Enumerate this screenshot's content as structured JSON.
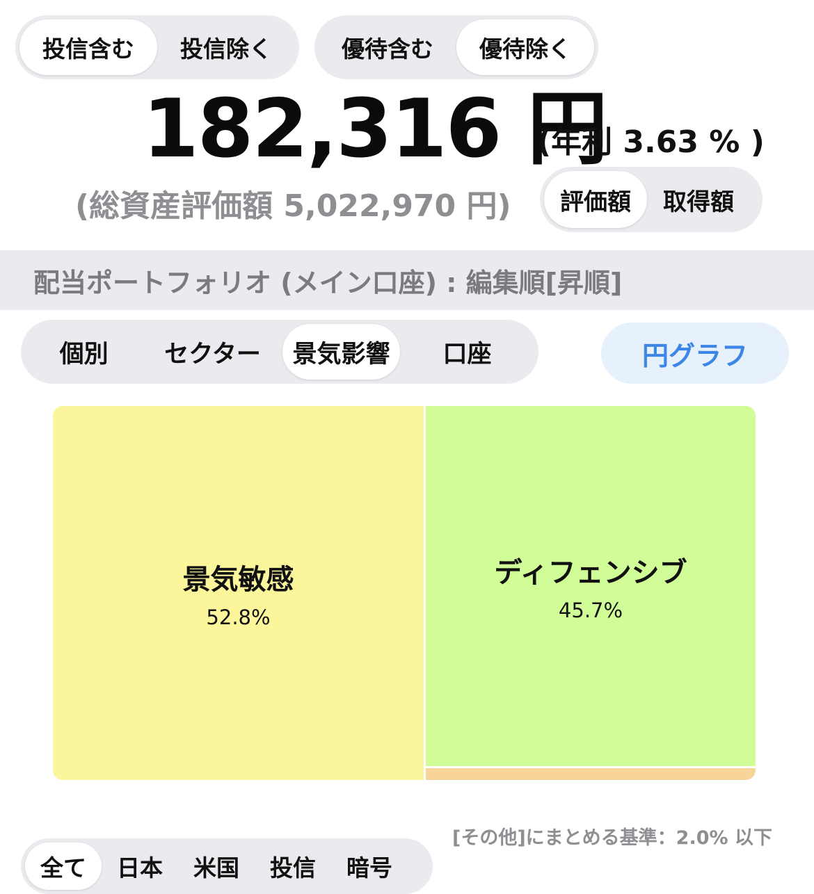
{
  "fund_toggle": {
    "options": [
      "投信含む",
      "投信除く"
    ],
    "selected": "投信含む"
  },
  "yutai_toggle": {
    "options": [
      "優待含む",
      "優待除く"
    ],
    "selected": "優待除く"
  },
  "annual_dividend": {
    "amount": "182,316 円",
    "yield_text": "(年利 3.63 % )"
  },
  "total_assets_text": "(総資産評価額 5,022,970 円)",
  "value_toggle": {
    "options": [
      "評価額",
      "取得額"
    ],
    "selected": "評価額"
  },
  "portfolio_title": "配当ポートフォリオ (メイン口座) : 編集順[昇順]",
  "category_tabs": {
    "options": [
      "個別",
      "セクター",
      "景気影響",
      "口座"
    ],
    "selected": "景気影響"
  },
  "chart_button_label": "円グラフ",
  "chart_data": {
    "type": "treemap",
    "items": [
      {
        "label": "景気敏感",
        "percent_text": "52.8%",
        "value": 52.8,
        "color": "#fbf59b"
      },
      {
        "label": "ディフェンシブ",
        "percent_text": "45.7%",
        "value": 45.7,
        "color": "#d1fd98"
      },
      {
        "label": "",
        "percent_text": "",
        "value": 1.5,
        "color": "#f7d59a"
      }
    ]
  },
  "other_threshold_note": "[その他]にまとめる基準：2.0% 以下",
  "bottom_tabs": {
    "options": [
      "全て",
      "日本",
      "米国",
      "投信",
      "暗号"
    ],
    "selected": "全て"
  }
}
